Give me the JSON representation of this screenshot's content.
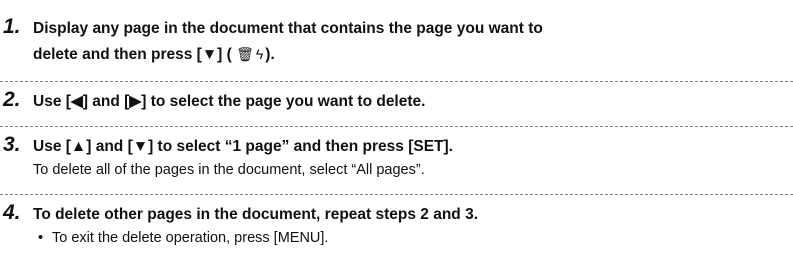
{
  "steps": [
    {
      "number": "1.",
      "line1": "Display any page in the document that contains the page you want to",
      "line2_text": "delete and then press [▼] (",
      "line2_icons": "🗑ϟ",
      "line2_end": ")."
    },
    {
      "number": "2.",
      "line1": "Use [◀] and [▶] to select the page you want to delete."
    },
    {
      "number": "3.",
      "line1": "Use [▲] and [▼] to select “1 page” and then press [SET].",
      "note": "To delete all of the pages in the document, select “All pages”."
    },
    {
      "number": "4.",
      "line1": "To delete other pages in the document, repeat steps 2 and 3.",
      "bullet": "•",
      "note": "To exit the delete operation, press [MENU]."
    }
  ]
}
